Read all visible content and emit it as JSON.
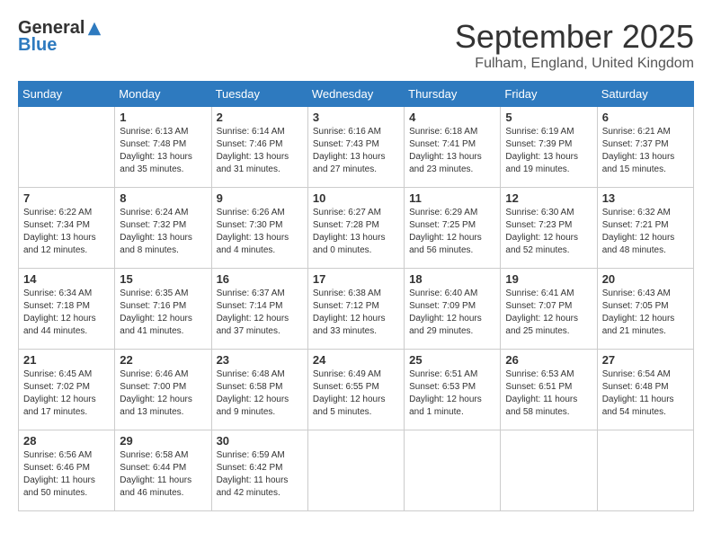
{
  "header": {
    "logo_general": "General",
    "logo_blue": "Blue",
    "month_title": "September 2025",
    "location": "Fulham, England, United Kingdom"
  },
  "weekdays": [
    "Sunday",
    "Monday",
    "Tuesday",
    "Wednesday",
    "Thursday",
    "Friday",
    "Saturday"
  ],
  "weeks": [
    [
      {
        "day": "",
        "info": ""
      },
      {
        "day": "1",
        "info": "Sunrise: 6:13 AM\nSunset: 7:48 PM\nDaylight: 13 hours\nand 35 minutes."
      },
      {
        "day": "2",
        "info": "Sunrise: 6:14 AM\nSunset: 7:46 PM\nDaylight: 13 hours\nand 31 minutes."
      },
      {
        "day": "3",
        "info": "Sunrise: 6:16 AM\nSunset: 7:43 PM\nDaylight: 13 hours\nand 27 minutes."
      },
      {
        "day": "4",
        "info": "Sunrise: 6:18 AM\nSunset: 7:41 PM\nDaylight: 13 hours\nand 23 minutes."
      },
      {
        "day": "5",
        "info": "Sunrise: 6:19 AM\nSunset: 7:39 PM\nDaylight: 13 hours\nand 19 minutes."
      },
      {
        "day": "6",
        "info": "Sunrise: 6:21 AM\nSunset: 7:37 PM\nDaylight: 13 hours\nand 15 minutes."
      }
    ],
    [
      {
        "day": "7",
        "info": "Sunrise: 6:22 AM\nSunset: 7:34 PM\nDaylight: 13 hours\nand 12 minutes."
      },
      {
        "day": "8",
        "info": "Sunrise: 6:24 AM\nSunset: 7:32 PM\nDaylight: 13 hours\nand 8 minutes."
      },
      {
        "day": "9",
        "info": "Sunrise: 6:26 AM\nSunset: 7:30 PM\nDaylight: 13 hours\nand 4 minutes."
      },
      {
        "day": "10",
        "info": "Sunrise: 6:27 AM\nSunset: 7:28 PM\nDaylight: 13 hours\nand 0 minutes."
      },
      {
        "day": "11",
        "info": "Sunrise: 6:29 AM\nSunset: 7:25 PM\nDaylight: 12 hours\nand 56 minutes."
      },
      {
        "day": "12",
        "info": "Sunrise: 6:30 AM\nSunset: 7:23 PM\nDaylight: 12 hours\nand 52 minutes."
      },
      {
        "day": "13",
        "info": "Sunrise: 6:32 AM\nSunset: 7:21 PM\nDaylight: 12 hours\nand 48 minutes."
      }
    ],
    [
      {
        "day": "14",
        "info": "Sunrise: 6:34 AM\nSunset: 7:18 PM\nDaylight: 12 hours\nand 44 minutes."
      },
      {
        "day": "15",
        "info": "Sunrise: 6:35 AM\nSunset: 7:16 PM\nDaylight: 12 hours\nand 41 minutes."
      },
      {
        "day": "16",
        "info": "Sunrise: 6:37 AM\nSunset: 7:14 PM\nDaylight: 12 hours\nand 37 minutes."
      },
      {
        "day": "17",
        "info": "Sunrise: 6:38 AM\nSunset: 7:12 PM\nDaylight: 12 hours\nand 33 minutes."
      },
      {
        "day": "18",
        "info": "Sunrise: 6:40 AM\nSunset: 7:09 PM\nDaylight: 12 hours\nand 29 minutes."
      },
      {
        "day": "19",
        "info": "Sunrise: 6:41 AM\nSunset: 7:07 PM\nDaylight: 12 hours\nand 25 minutes."
      },
      {
        "day": "20",
        "info": "Sunrise: 6:43 AM\nSunset: 7:05 PM\nDaylight: 12 hours\nand 21 minutes."
      }
    ],
    [
      {
        "day": "21",
        "info": "Sunrise: 6:45 AM\nSunset: 7:02 PM\nDaylight: 12 hours\nand 17 minutes."
      },
      {
        "day": "22",
        "info": "Sunrise: 6:46 AM\nSunset: 7:00 PM\nDaylight: 12 hours\nand 13 minutes."
      },
      {
        "day": "23",
        "info": "Sunrise: 6:48 AM\nSunset: 6:58 PM\nDaylight: 12 hours\nand 9 minutes."
      },
      {
        "day": "24",
        "info": "Sunrise: 6:49 AM\nSunset: 6:55 PM\nDaylight: 12 hours\nand 5 minutes."
      },
      {
        "day": "25",
        "info": "Sunrise: 6:51 AM\nSunset: 6:53 PM\nDaylight: 12 hours\nand 1 minute."
      },
      {
        "day": "26",
        "info": "Sunrise: 6:53 AM\nSunset: 6:51 PM\nDaylight: 11 hours\nand 58 minutes."
      },
      {
        "day": "27",
        "info": "Sunrise: 6:54 AM\nSunset: 6:48 PM\nDaylight: 11 hours\nand 54 minutes."
      }
    ],
    [
      {
        "day": "28",
        "info": "Sunrise: 6:56 AM\nSunset: 6:46 PM\nDaylight: 11 hours\nand 50 minutes."
      },
      {
        "day": "29",
        "info": "Sunrise: 6:58 AM\nSunset: 6:44 PM\nDaylight: 11 hours\nand 46 minutes."
      },
      {
        "day": "30",
        "info": "Sunrise: 6:59 AM\nSunset: 6:42 PM\nDaylight: 11 hours\nand 42 minutes."
      },
      {
        "day": "",
        "info": ""
      },
      {
        "day": "",
        "info": ""
      },
      {
        "day": "",
        "info": ""
      },
      {
        "day": "",
        "info": ""
      }
    ]
  ]
}
